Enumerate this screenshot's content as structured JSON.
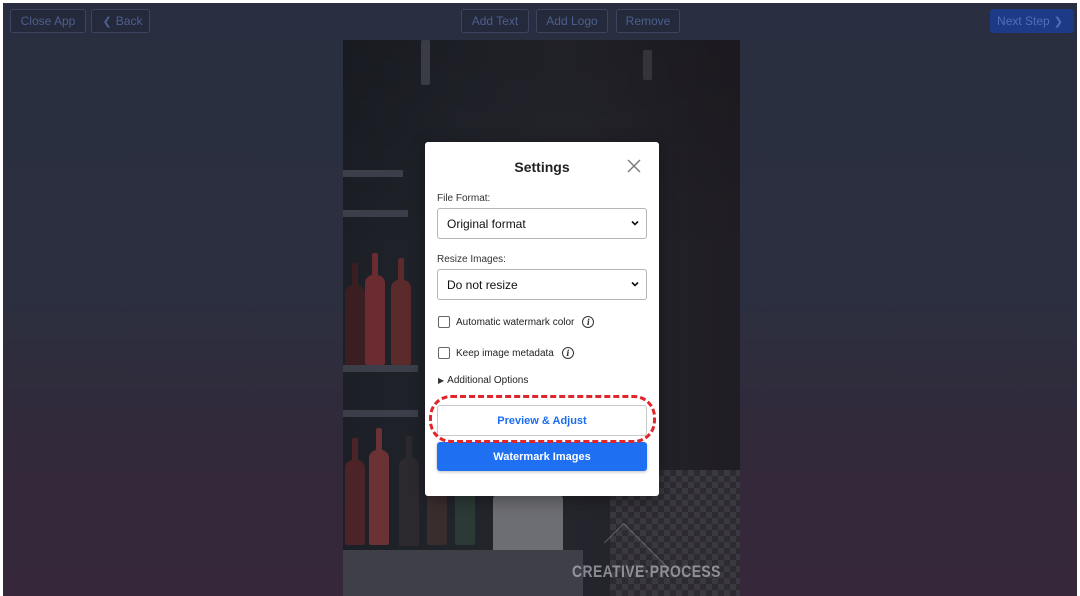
{
  "toolbar": {
    "close_app": "Close App",
    "back": "Back",
    "add_text": "Add Text",
    "add_logo": "Add Logo",
    "remove": "Remove",
    "next_step": "Next Step"
  },
  "photo": {
    "watermark_text": "CREATIVE·PROCESS"
  },
  "settings": {
    "title": "Settings",
    "file_format_label": "File Format:",
    "file_format_value": "Original format",
    "resize_label": "Resize Images:",
    "resize_value": "Do not resize",
    "auto_color_label": "Automatic watermark color",
    "keep_metadata_label": "Keep image metadata",
    "additional_options": "Additional Options",
    "preview_button": "Preview & Adjust",
    "watermark_button": "Watermark Images"
  },
  "colors": {
    "primary": "#1e6ff2",
    "highlight": "#e0262a",
    "overlay": "#2a2f40"
  }
}
